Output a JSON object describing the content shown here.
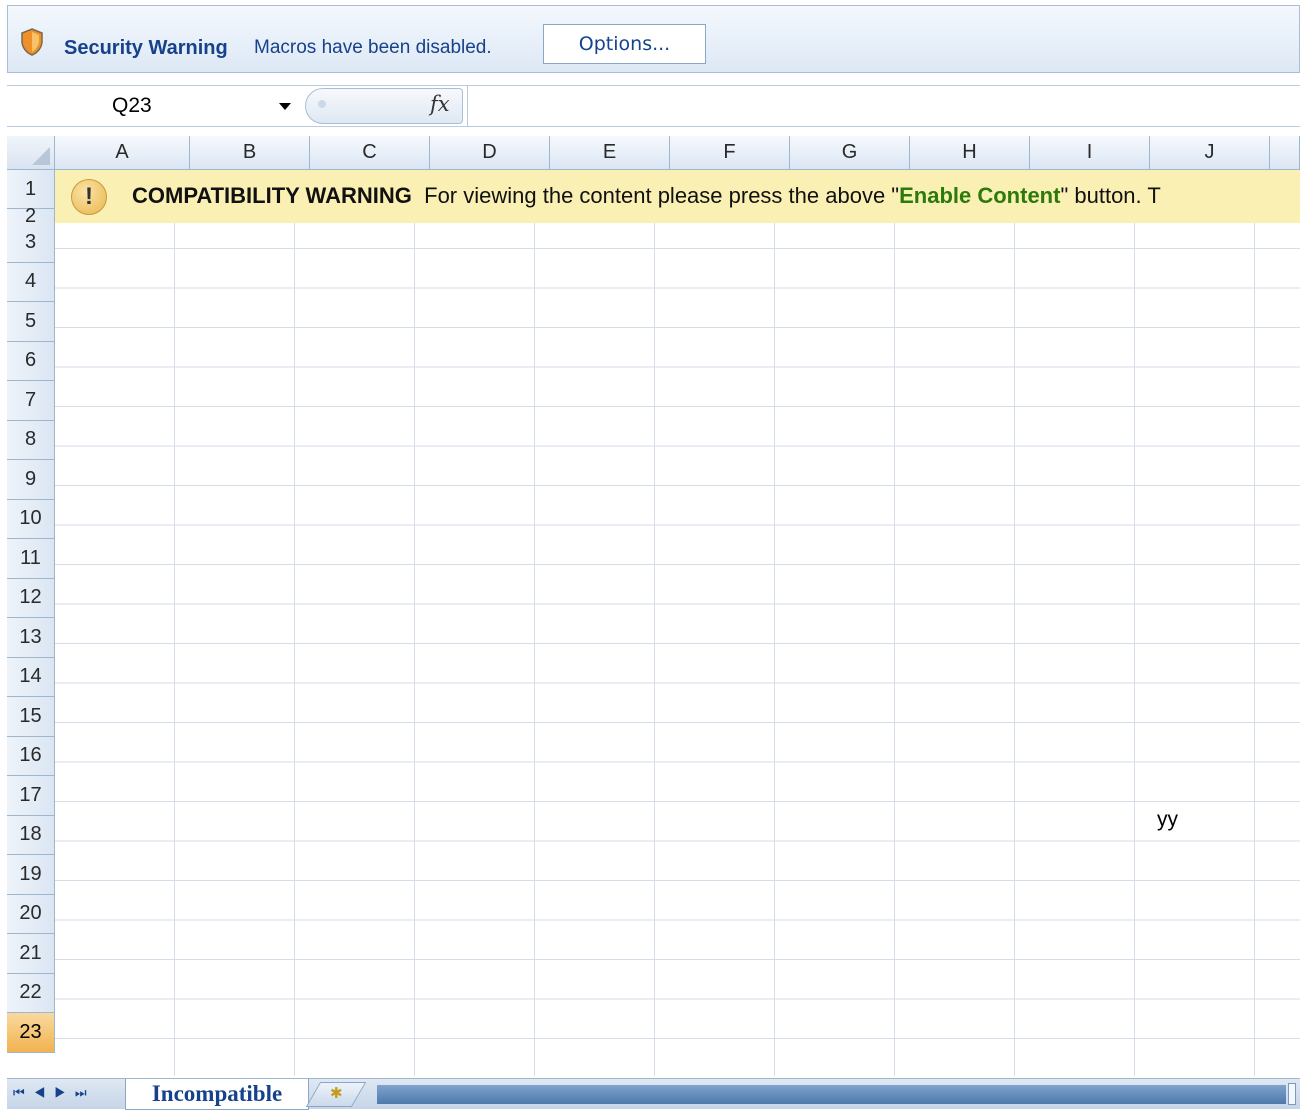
{
  "security_bar": {
    "title": "Security Warning",
    "message": "Macros have been disabled.",
    "options_label": "Options..."
  },
  "formula_bar": {
    "name_box": "Q23",
    "fx_label": "fx",
    "formula": ""
  },
  "columns": [
    "A",
    "B",
    "C",
    "D",
    "E",
    "F",
    "G",
    "H",
    "I",
    "J"
  ],
  "rows": [
    "1",
    "2",
    "3",
    "4",
    "5",
    "6",
    "7",
    "8",
    "9",
    "10",
    "11",
    "12",
    "13",
    "14",
    "15",
    "16",
    "17",
    "18",
    "19",
    "20",
    "21",
    "22",
    "23"
  ],
  "active_row": "23",
  "banner": {
    "icon": "!",
    "heading": "COMPATIBILITY WARNING",
    "text_before": "For viewing the content please press the above \"",
    "highlight": "Enable Content",
    "text_after": "\" button. T"
  },
  "cells": {
    "J17": "yy"
  },
  "sheet_tabs": {
    "active": "Incompatible",
    "nav_icons": [
      "first-sheet-icon",
      "prev-sheet-icon",
      "next-sheet-icon",
      "last-sheet-icon"
    ],
    "new_sheet_icon": "insert-sheet-icon"
  },
  "colors": {
    "banner_bg": "#fbf0b4",
    "highlight_green": "#2b7a0b",
    "active_row_header": "#f2b34f",
    "accent_blue": "#15428b"
  }
}
